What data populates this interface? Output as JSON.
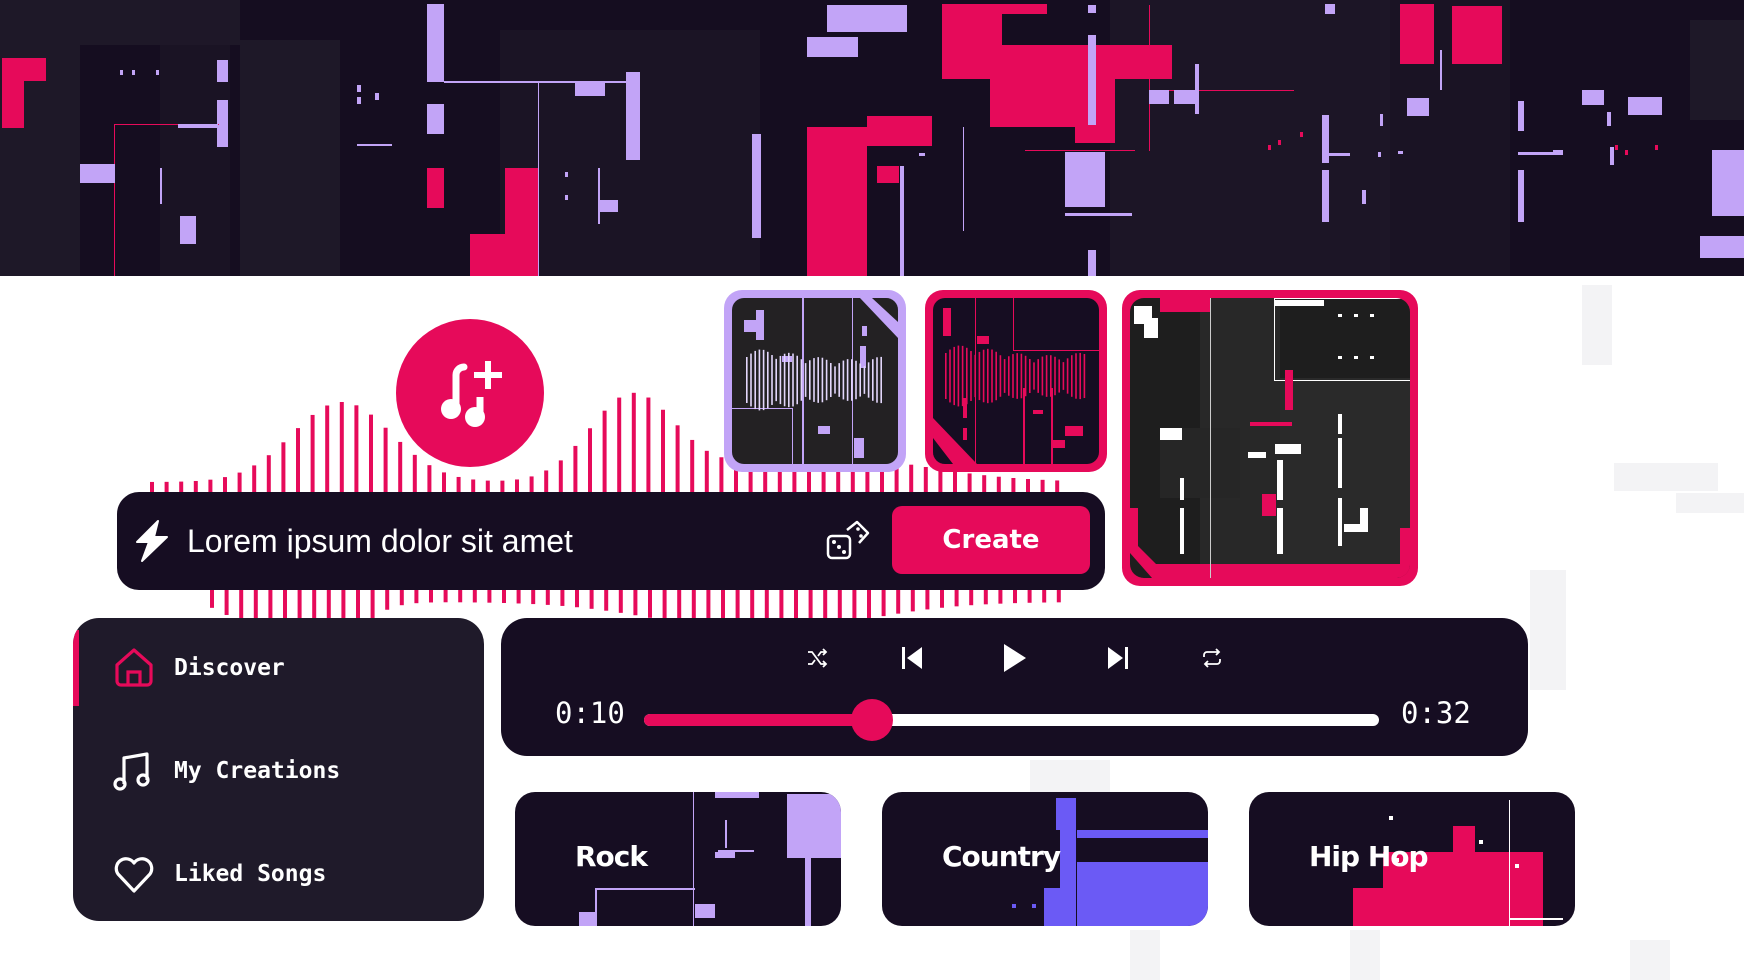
{
  "theme": {
    "accent": "#e60a5a",
    "lavender": "#c2a4f7",
    "violet": "#6b5af5",
    "panel": "#160d22",
    "sidebar_bg": "#1f1a2a"
  },
  "fab": {
    "icon": "music-note-add-icon"
  },
  "prompt": {
    "leading_icon": "lightning-bolt-icon",
    "value": "Lorem ipsum dolor sit amet",
    "randomize_icon": "dice-icon",
    "create_label": "Create"
  },
  "thumbnails": [
    {
      "name": "track-thumbnail-lavender",
      "frame_color": "#c2a4f7",
      "selected": false
    },
    {
      "name": "track-thumbnail-pink",
      "frame_color": "#e60a5a",
      "selected": false
    },
    {
      "name": "track-thumbnail-large",
      "frame_color": "#e60a5a",
      "selected": true
    }
  ],
  "sidebar": {
    "items": [
      {
        "label": "Discover",
        "icon": "home-icon",
        "active": true
      },
      {
        "label": "My Creations",
        "icon": "music-note-icon",
        "active": false
      },
      {
        "label": "Liked Songs",
        "icon": "heart-icon",
        "active": false
      }
    ]
  },
  "player": {
    "controls": [
      {
        "name": "shuffle",
        "icon": "shuffle-icon"
      },
      {
        "name": "previous",
        "icon": "skip-previous-icon"
      },
      {
        "name": "play",
        "icon": "play-icon"
      },
      {
        "name": "next",
        "icon": "skip-next-icon"
      },
      {
        "name": "repeat",
        "icon": "repeat-icon"
      }
    ],
    "elapsed": "0:10",
    "duration": "0:32",
    "progress_percent": 31
  },
  "genres": [
    {
      "label": "Rock"
    },
    {
      "label": "Country"
    },
    {
      "label": "Hip Hop"
    }
  ]
}
